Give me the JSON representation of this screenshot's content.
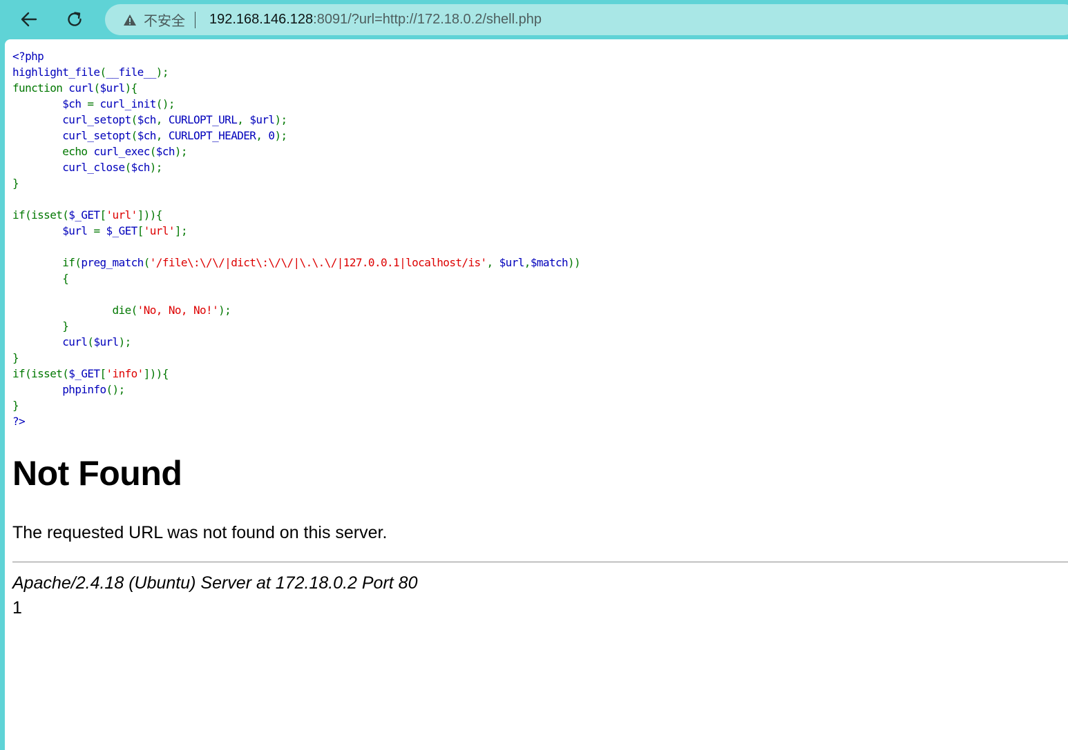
{
  "browser": {
    "security_label": "不安全",
    "url_host": "192.168.146.128",
    "url_rest": ":8091/?url=http://172.18.0.2/shell.php"
  },
  "code_lines": [
    [
      {
        "t": "<?php",
        "c": "d"
      }
    ],
    [
      {
        "t": "highlight_file",
        "c": "d"
      },
      {
        "t": "(",
        "c": "k"
      },
      {
        "t": "__file__",
        "c": "d"
      },
      {
        "t": ");",
        "c": "k"
      }
    ],
    [
      {
        "t": "function ",
        "c": "k"
      },
      {
        "t": "curl",
        "c": "d"
      },
      {
        "t": "(",
        "c": "k"
      },
      {
        "t": "$url",
        "c": "d"
      },
      {
        "t": "){",
        "c": "k"
      }
    ],
    [
      {
        "t": "        ",
        "c": "k"
      },
      {
        "t": "$ch ",
        "c": "d"
      },
      {
        "t": "= ",
        "c": "k"
      },
      {
        "t": "curl_init",
        "c": "d"
      },
      {
        "t": "();",
        "c": "k"
      }
    ],
    [
      {
        "t": "        ",
        "c": "k"
      },
      {
        "t": "curl_setopt",
        "c": "d"
      },
      {
        "t": "(",
        "c": "k"
      },
      {
        "t": "$ch",
        "c": "d"
      },
      {
        "t": ", ",
        "c": "k"
      },
      {
        "t": "CURLOPT_URL",
        "c": "d"
      },
      {
        "t": ", ",
        "c": "k"
      },
      {
        "t": "$url",
        "c": "d"
      },
      {
        "t": ");",
        "c": "k"
      }
    ],
    [
      {
        "t": "        ",
        "c": "k"
      },
      {
        "t": "curl_setopt",
        "c": "d"
      },
      {
        "t": "(",
        "c": "k"
      },
      {
        "t": "$ch",
        "c": "d"
      },
      {
        "t": ", ",
        "c": "k"
      },
      {
        "t": "CURLOPT_HEADER",
        "c": "d"
      },
      {
        "t": ", ",
        "c": "k"
      },
      {
        "t": "0",
        "c": "d"
      },
      {
        "t": ");",
        "c": "k"
      }
    ],
    [
      {
        "t": "        echo ",
        "c": "k"
      },
      {
        "t": "curl_exec",
        "c": "d"
      },
      {
        "t": "(",
        "c": "k"
      },
      {
        "t": "$ch",
        "c": "d"
      },
      {
        "t": ");",
        "c": "k"
      }
    ],
    [
      {
        "t": "        ",
        "c": "k"
      },
      {
        "t": "curl_close",
        "c": "d"
      },
      {
        "t": "(",
        "c": "k"
      },
      {
        "t": "$ch",
        "c": "d"
      },
      {
        "t": ");",
        "c": "k"
      }
    ],
    [
      {
        "t": "}",
        "c": "k"
      }
    ],
    [
      {
        "t": "",
        "c": "k"
      }
    ],
    [
      {
        "t": "if(isset(",
        "c": "k"
      },
      {
        "t": "$_GET",
        "c": "d"
      },
      {
        "t": "[",
        "c": "k"
      },
      {
        "t": "'url'",
        "c": "s"
      },
      {
        "t": "])){",
        "c": "k"
      }
    ],
    [
      {
        "t": "        ",
        "c": "k"
      },
      {
        "t": "$url ",
        "c": "d"
      },
      {
        "t": "= ",
        "c": "k"
      },
      {
        "t": "$_GET",
        "c": "d"
      },
      {
        "t": "[",
        "c": "k"
      },
      {
        "t": "'url'",
        "c": "s"
      },
      {
        "t": "];",
        "c": "k"
      }
    ],
    [
      {
        "t": "",
        "c": "k"
      }
    ],
    [
      {
        "t": "        if(",
        "c": "k"
      },
      {
        "t": "preg_match",
        "c": "d"
      },
      {
        "t": "(",
        "c": "k"
      },
      {
        "t": "'/file\\:\\/\\/|dict\\:\\/\\/|\\.\\.\\/|127.0.0.1|localhost/is'",
        "c": "s"
      },
      {
        "t": ", ",
        "c": "k"
      },
      {
        "t": "$url",
        "c": "d"
      },
      {
        "t": ",",
        "c": "k"
      },
      {
        "t": "$match",
        "c": "d"
      },
      {
        "t": "))",
        "c": "k"
      }
    ],
    [
      {
        "t": "        {",
        "c": "k"
      }
    ],
    [
      {
        "t": "",
        "c": "k"
      }
    ],
    [
      {
        "t": "                die(",
        "c": "k"
      },
      {
        "t": "'No, No, No!'",
        "c": "s"
      },
      {
        "t": ");",
        "c": "k"
      }
    ],
    [
      {
        "t": "        }",
        "c": "k"
      }
    ],
    [
      {
        "t": "        ",
        "c": "k"
      },
      {
        "t": "curl",
        "c": "d"
      },
      {
        "t": "(",
        "c": "k"
      },
      {
        "t": "$url",
        "c": "d"
      },
      {
        "t": ");",
        "c": "k"
      }
    ],
    [
      {
        "t": "}",
        "c": "k"
      }
    ],
    [
      {
        "t": "if(isset(",
        "c": "k"
      },
      {
        "t": "$_GET",
        "c": "d"
      },
      {
        "t": "[",
        "c": "k"
      },
      {
        "t": "'info'",
        "c": "s"
      },
      {
        "t": "])){",
        "c": "k"
      }
    ],
    [
      {
        "t": "        ",
        "c": "k"
      },
      {
        "t": "phpinfo",
        "c": "d"
      },
      {
        "t": "();",
        "c": "k"
      }
    ],
    [
      {
        "t": "}",
        "c": "k"
      }
    ],
    [
      {
        "t": "?>",
        "c": "d"
      }
    ]
  ],
  "error": {
    "title": "Not Found",
    "message": "The requested URL was not found on this server.",
    "address": "Apache/2.4.18 (Ubuntu) Server at 172.18.0.2 Port 80"
  },
  "output": "1",
  "colors": {
    "frame": "#5fd3d6",
    "omnibox": "#a9e7e6",
    "php_keyword": "#007700",
    "php_default": "#0000bb",
    "php_string": "#dd0000"
  }
}
